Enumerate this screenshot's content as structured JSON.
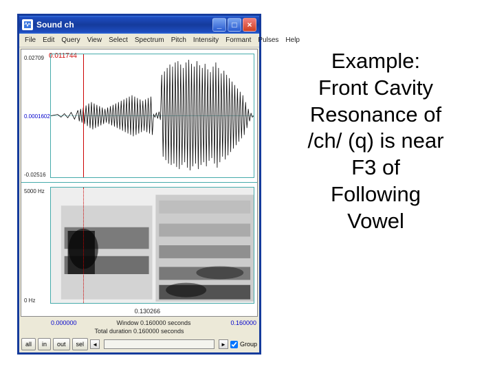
{
  "app": {
    "title": "Sound ch",
    "menus": [
      "File",
      "Edit",
      "Query",
      "View",
      "Select",
      "Spectrum",
      "Pitch",
      "Intensity",
      "Formant",
      "Pulses"
    ],
    "help": "Help"
  },
  "wave": {
    "cursor_value": "0.011744",
    "ytop": "0.02709",
    "ymid": "0.0001602",
    "ybot": "-0.02516"
  },
  "spec": {
    "ytop": "5000 Hz",
    "ybot": "0 Hz",
    "cursor_bottom": "0.130266"
  },
  "time": {
    "visible_start": "0.000000",
    "window_label": "Window 0.160000 seconds",
    "visible_end": "0.160000",
    "total_label": "Total duration 0.160000 seconds"
  },
  "tools": {
    "all": "all",
    "in": "in",
    "out": "out",
    "sel": "sel",
    "group": "Group"
  },
  "heading": "Example:\nFront Cavity\nResonance of\n/ch/ (q) is near\nF3 of\nFollowing\nVowel"
}
